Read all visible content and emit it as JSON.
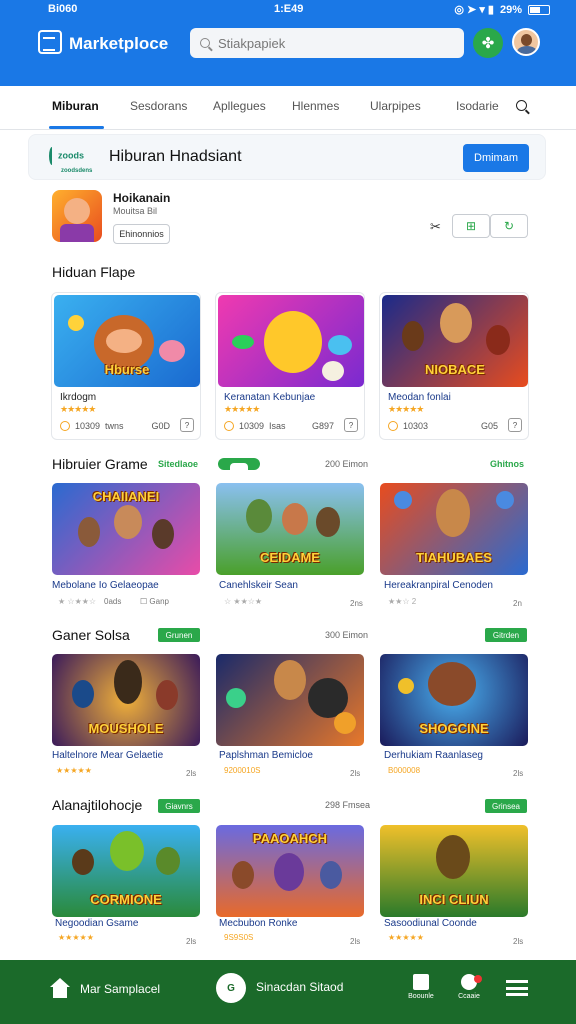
{
  "status": {
    "left": "Bi060",
    "time": "1:E49",
    "right": "29%"
  },
  "app": {
    "title": "Marketploce",
    "search_placeholder": "Stiakpapiek"
  },
  "tabs": [
    {
      "label": "Miburan"
    },
    {
      "label": "Sesdorans"
    },
    {
      "label": "Apllegues"
    },
    {
      "label": "Hlenmes"
    },
    {
      "label": "Ularpipes"
    },
    {
      "label": "Isodarie"
    }
  ],
  "banner": {
    "logo_text": "zoods",
    "logo_sub": "zoodsdens",
    "title": "Hiburan Hnadsiant",
    "button": "Dmimam"
  },
  "featured": {
    "name": "Hoikanain",
    "sub": "Mouitsa Bil",
    "button": "Ehinonnios"
  },
  "sections": [
    {
      "title": "Hiduan Flape"
    },
    {
      "title": "Hibruier Grame",
      "link": "Sitedlaoe",
      "count": "200 Eimon",
      "right": "Ghitnos"
    },
    {
      "title": "Ganer Solsa",
      "badge": "Grunen",
      "count": "300 Eimon",
      "right": "Gitrden"
    },
    {
      "title": "Alanajtilohocje",
      "badge": "Giavnrs",
      "count": "298 Fmsea",
      "right": "Grinsea"
    }
  ],
  "row1": [
    {
      "img_label": "Hburse",
      "name": "Ikrdogm",
      "stars": "★★★★★",
      "m1": "10309",
      "m2": "twns",
      "m3": "G0D"
    },
    {
      "img_label": "",
      "name": "Keranatan Kebunjae",
      "stars": "★★★★★",
      "m1": "10309",
      "m2": "Isas",
      "m3": "G897"
    },
    {
      "img_label": "NIOBACE",
      "name": "Meodan fonlai",
      "stars": "★★★★★",
      "m1": "10303",
      "m2": "",
      "m3": "G05"
    }
  ],
  "row2": [
    {
      "img_label": "CHAIIANEI",
      "name": "Mebolane Io Gelaeopae",
      "stars": "★ ☆★★☆",
      "s1": "0ads",
      "s2": "Ganp"
    },
    {
      "img_label": "CEIDAME",
      "name": "Canehlskeir Sean",
      "stars": "☆ ★★☆★",
      "s1": "",
      "s2": "2ns"
    },
    {
      "img_label": "TIAHUBAES",
      "name": "Hereakranpiral Cenoden",
      "stars": "★★☆ 2",
      "s1": "",
      "s2": "2n"
    }
  ],
  "row3": [
    {
      "img_label": "MOUSHOLE",
      "name": "Haltelnore Mear Gelaetie",
      "stars": "★★★★★",
      "s1": "",
      "s2": "2ls"
    },
    {
      "img_label": "",
      "name": "Paplshman Bemicloe",
      "stars": "9200010S",
      "s1": "",
      "s2": "2ls"
    },
    {
      "img_label": "SHOGCINE",
      "name": "Derhukiam Raanlaseg",
      "stars": "B000008",
      "s1": "",
      "s2": "2ls"
    }
  ],
  "row4": [
    {
      "img_label": "CORMIONE",
      "name": "Negoodian Gsame",
      "stars": "★★★★★",
      "s2": "2ls"
    },
    {
      "img_label": "PAAOAHCH",
      "name": "Mecbubon Ronke",
      "stars": "9S9S0S",
      "s2": "2ls"
    },
    {
      "img_label": "INCI CLIUN",
      "name": "Sasoodiunal Coonde",
      "stars": "★★★★★",
      "s2": "2ls"
    }
  ],
  "bottom": {
    "home_label": "Mar Samplacel",
    "center_icon": "G",
    "center_text": "Sinacdan Sitaod",
    "item1": "Boounle",
    "item2": "Ccaaie"
  }
}
